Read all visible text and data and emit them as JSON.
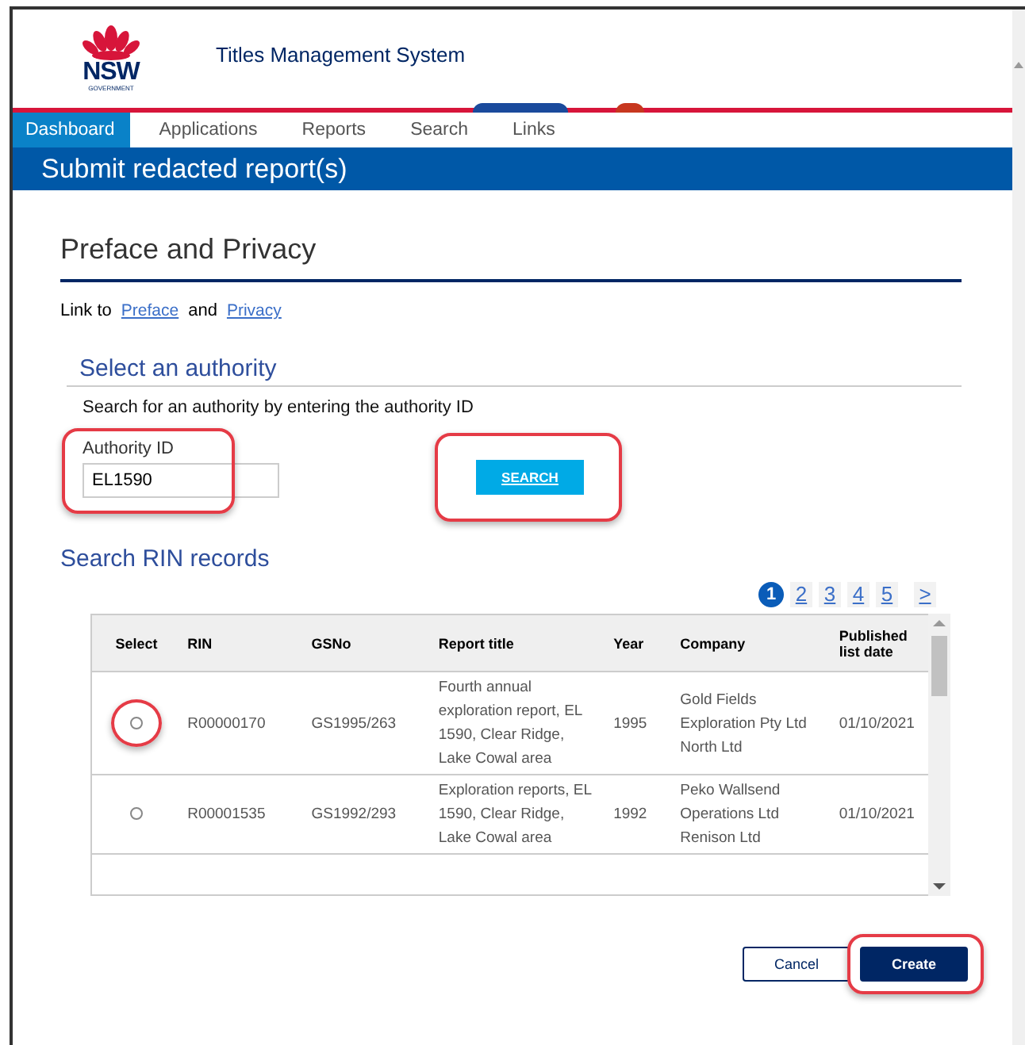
{
  "header": {
    "logo_text": "NSW",
    "logo_subtext": "GOVERNMENT",
    "title": "Titles Management System"
  },
  "nav": [
    {
      "label": "Dashboard",
      "selected": true
    },
    {
      "label": "Applications",
      "selected": false
    },
    {
      "label": "Reports",
      "selected": false
    },
    {
      "label": "Search",
      "selected": false
    },
    {
      "label": "Links",
      "selected": false
    }
  ],
  "page_title": "Submit redacted report(s)",
  "section_title": "Preface and Privacy",
  "links_line": {
    "prefix": "Link to",
    "links": [
      "Preface",
      "Privacy"
    ],
    "joiner": "and"
  },
  "authority": {
    "heading": "Select an authority",
    "instructions": "Search for an authority by entering the authority ID",
    "field_label": "Authority ID",
    "value": "EL1590",
    "field_highlighted": true,
    "button": "SEARCH",
    "button_highlighted": true
  },
  "records": {
    "heading": "Search RIN records",
    "pages": [
      {
        "label": "1",
        "selected": true
      },
      {
        "label": "2",
        "selected": false
      },
      {
        "label": "3",
        "selected": false
      },
      {
        "label": "4",
        "selected": false
      },
      {
        "label": "5",
        "selected": false
      }
    ],
    "next": ">",
    "columns": [
      "Select",
      "RIN",
      "GSNo",
      "Report title",
      "Year",
      "Company",
      "Published list date"
    ],
    "rows": [
      {
        "selected": false,
        "highlighted": true,
        "rin": "R00000170",
        "gsno": "GS1995/263",
        "title": "Fourth annual exploration report, EL 1590, Clear Ridge, Lake Cowal area",
        "year": "1995",
        "company": "Gold Fields Exploration Pty Ltd North Ltd",
        "date": "01/10/2021"
      },
      {
        "selected": false,
        "highlighted": false,
        "rin": "R00001535",
        "gsno": "GS1992/293",
        "title": "Exploration reports, EL 1590, Clear Ridge, Lake Cowal area",
        "year": "1992",
        "company": "Peko Wallsend Operations Ltd Renison Ltd",
        "date": "01/10/2021"
      }
    ]
  },
  "buttons": [
    {
      "label": "Cancel",
      "kind": "secondary",
      "highlighted": false
    },
    {
      "label": "Create",
      "kind": "primary",
      "highlighted": true
    }
  ]
}
